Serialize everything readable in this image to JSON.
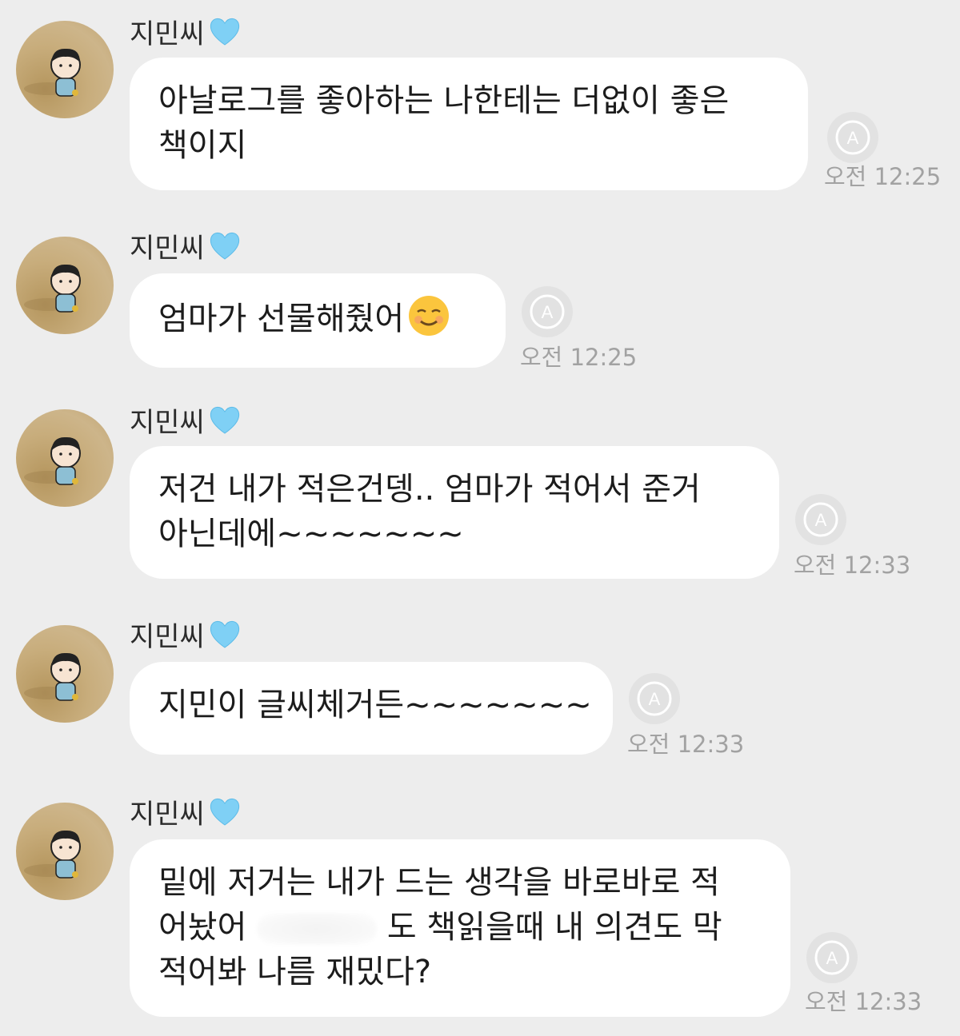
{
  "messages": [
    {
      "sender": "지민씨",
      "lines": [
        "아날로그를 좋아하는 나한테는 더없이 좋은",
        "책이지"
      ],
      "time": "오전 12:25"
    },
    {
      "sender": "지민씨",
      "lines": [
        "엄마가 선물해줬어"
      ],
      "emoji": "smiling-face-emoji",
      "time": "오전 12:25"
    },
    {
      "sender": "지민씨",
      "lines": [
        "저건 내가 적은건뎅.. 엄마가 적어서 준거",
        "아닌데에~~~~~~~"
      ],
      "time": "오전 12:33"
    },
    {
      "sender": "지민씨",
      "lines": [
        "지민이 글씨체거든~~~~~~~"
      ],
      "time": "오전 12:33"
    },
    {
      "sender": "지민씨",
      "lines": [
        "밑에 저거는 내가 드는 생각을 바로바로 적",
        "어놨어",
        "도 책읽을때 내 의견도 막",
        "적어봐 나름 재밌다?"
      ],
      "time": "오전 12:33"
    }
  ],
  "colors": {
    "background": "#ededed",
    "bubble": "#ffffff",
    "heart": "#7fd0f5",
    "timestamp": "#a2a2a2"
  },
  "icons": {
    "heart": "light-blue-heart-icon",
    "translate": "auto-translate-icon"
  }
}
